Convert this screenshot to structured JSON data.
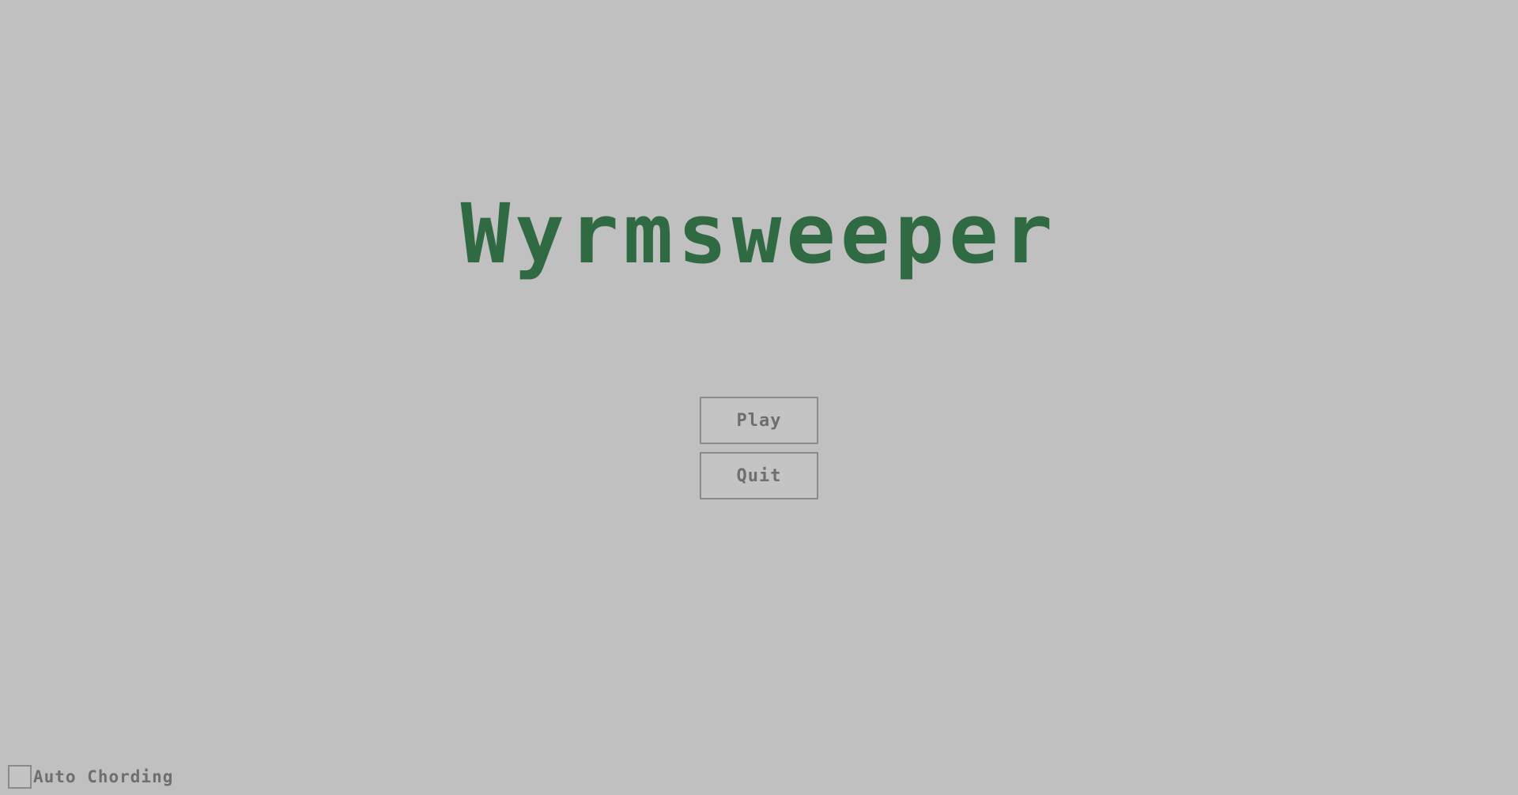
{
  "game": {
    "title": "Wyrmsweeper",
    "title_color": "#306a43",
    "background_color": "#c0c0c0"
  },
  "menu": {
    "play_label": "Play",
    "quit_label": "Quit"
  },
  "options": {
    "auto_chording_label": "Auto Chording",
    "auto_chording_checked": false
  }
}
